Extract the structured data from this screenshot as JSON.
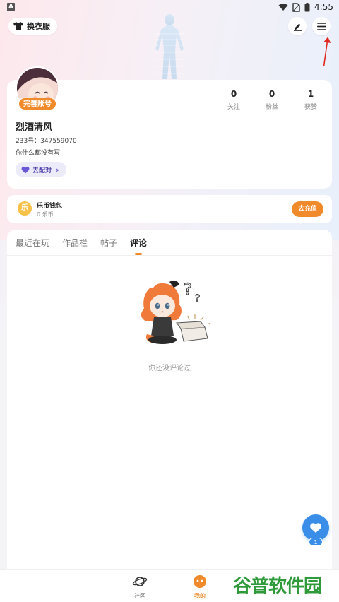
{
  "status_bar": {
    "app_badge": "A",
    "time": "4:55"
  },
  "header": {
    "dress_label": "换衣服"
  },
  "profile": {
    "complete_badge": "完善账号",
    "username": "烈酒清风",
    "uid_line": "233号：347559070",
    "bio": "你什么都没有写",
    "match_label": "去配对",
    "stats": [
      {
        "value": "0",
        "label": "关注"
      },
      {
        "value": "0",
        "label": "粉丝"
      },
      {
        "value": "1",
        "label": "获赞"
      }
    ]
  },
  "wallet": {
    "icon_text": "乐",
    "title": "乐币钱包",
    "balance": "0 乐币",
    "recharge_label": "去充值"
  },
  "tabs": [
    {
      "label": "最近在玩",
      "active": false
    },
    {
      "label": "作品栏",
      "active": false
    },
    {
      "label": "帖子",
      "active": false
    },
    {
      "label": "评论",
      "active": true
    }
  ],
  "empty_state": {
    "text": "你还没评论过"
  },
  "fab": {
    "count": "1"
  },
  "bottom_nav": [
    {
      "label": "社区",
      "icon": "planet-icon",
      "active": false
    },
    {
      "label": "我的",
      "icon": "face-icon",
      "active": true
    }
  ],
  "watermark": {
    "text": "谷普软件园"
  },
  "colors": {
    "accent": "#f18a2a",
    "fab": "#3a8ee8",
    "match": "#4b3fa8"
  }
}
